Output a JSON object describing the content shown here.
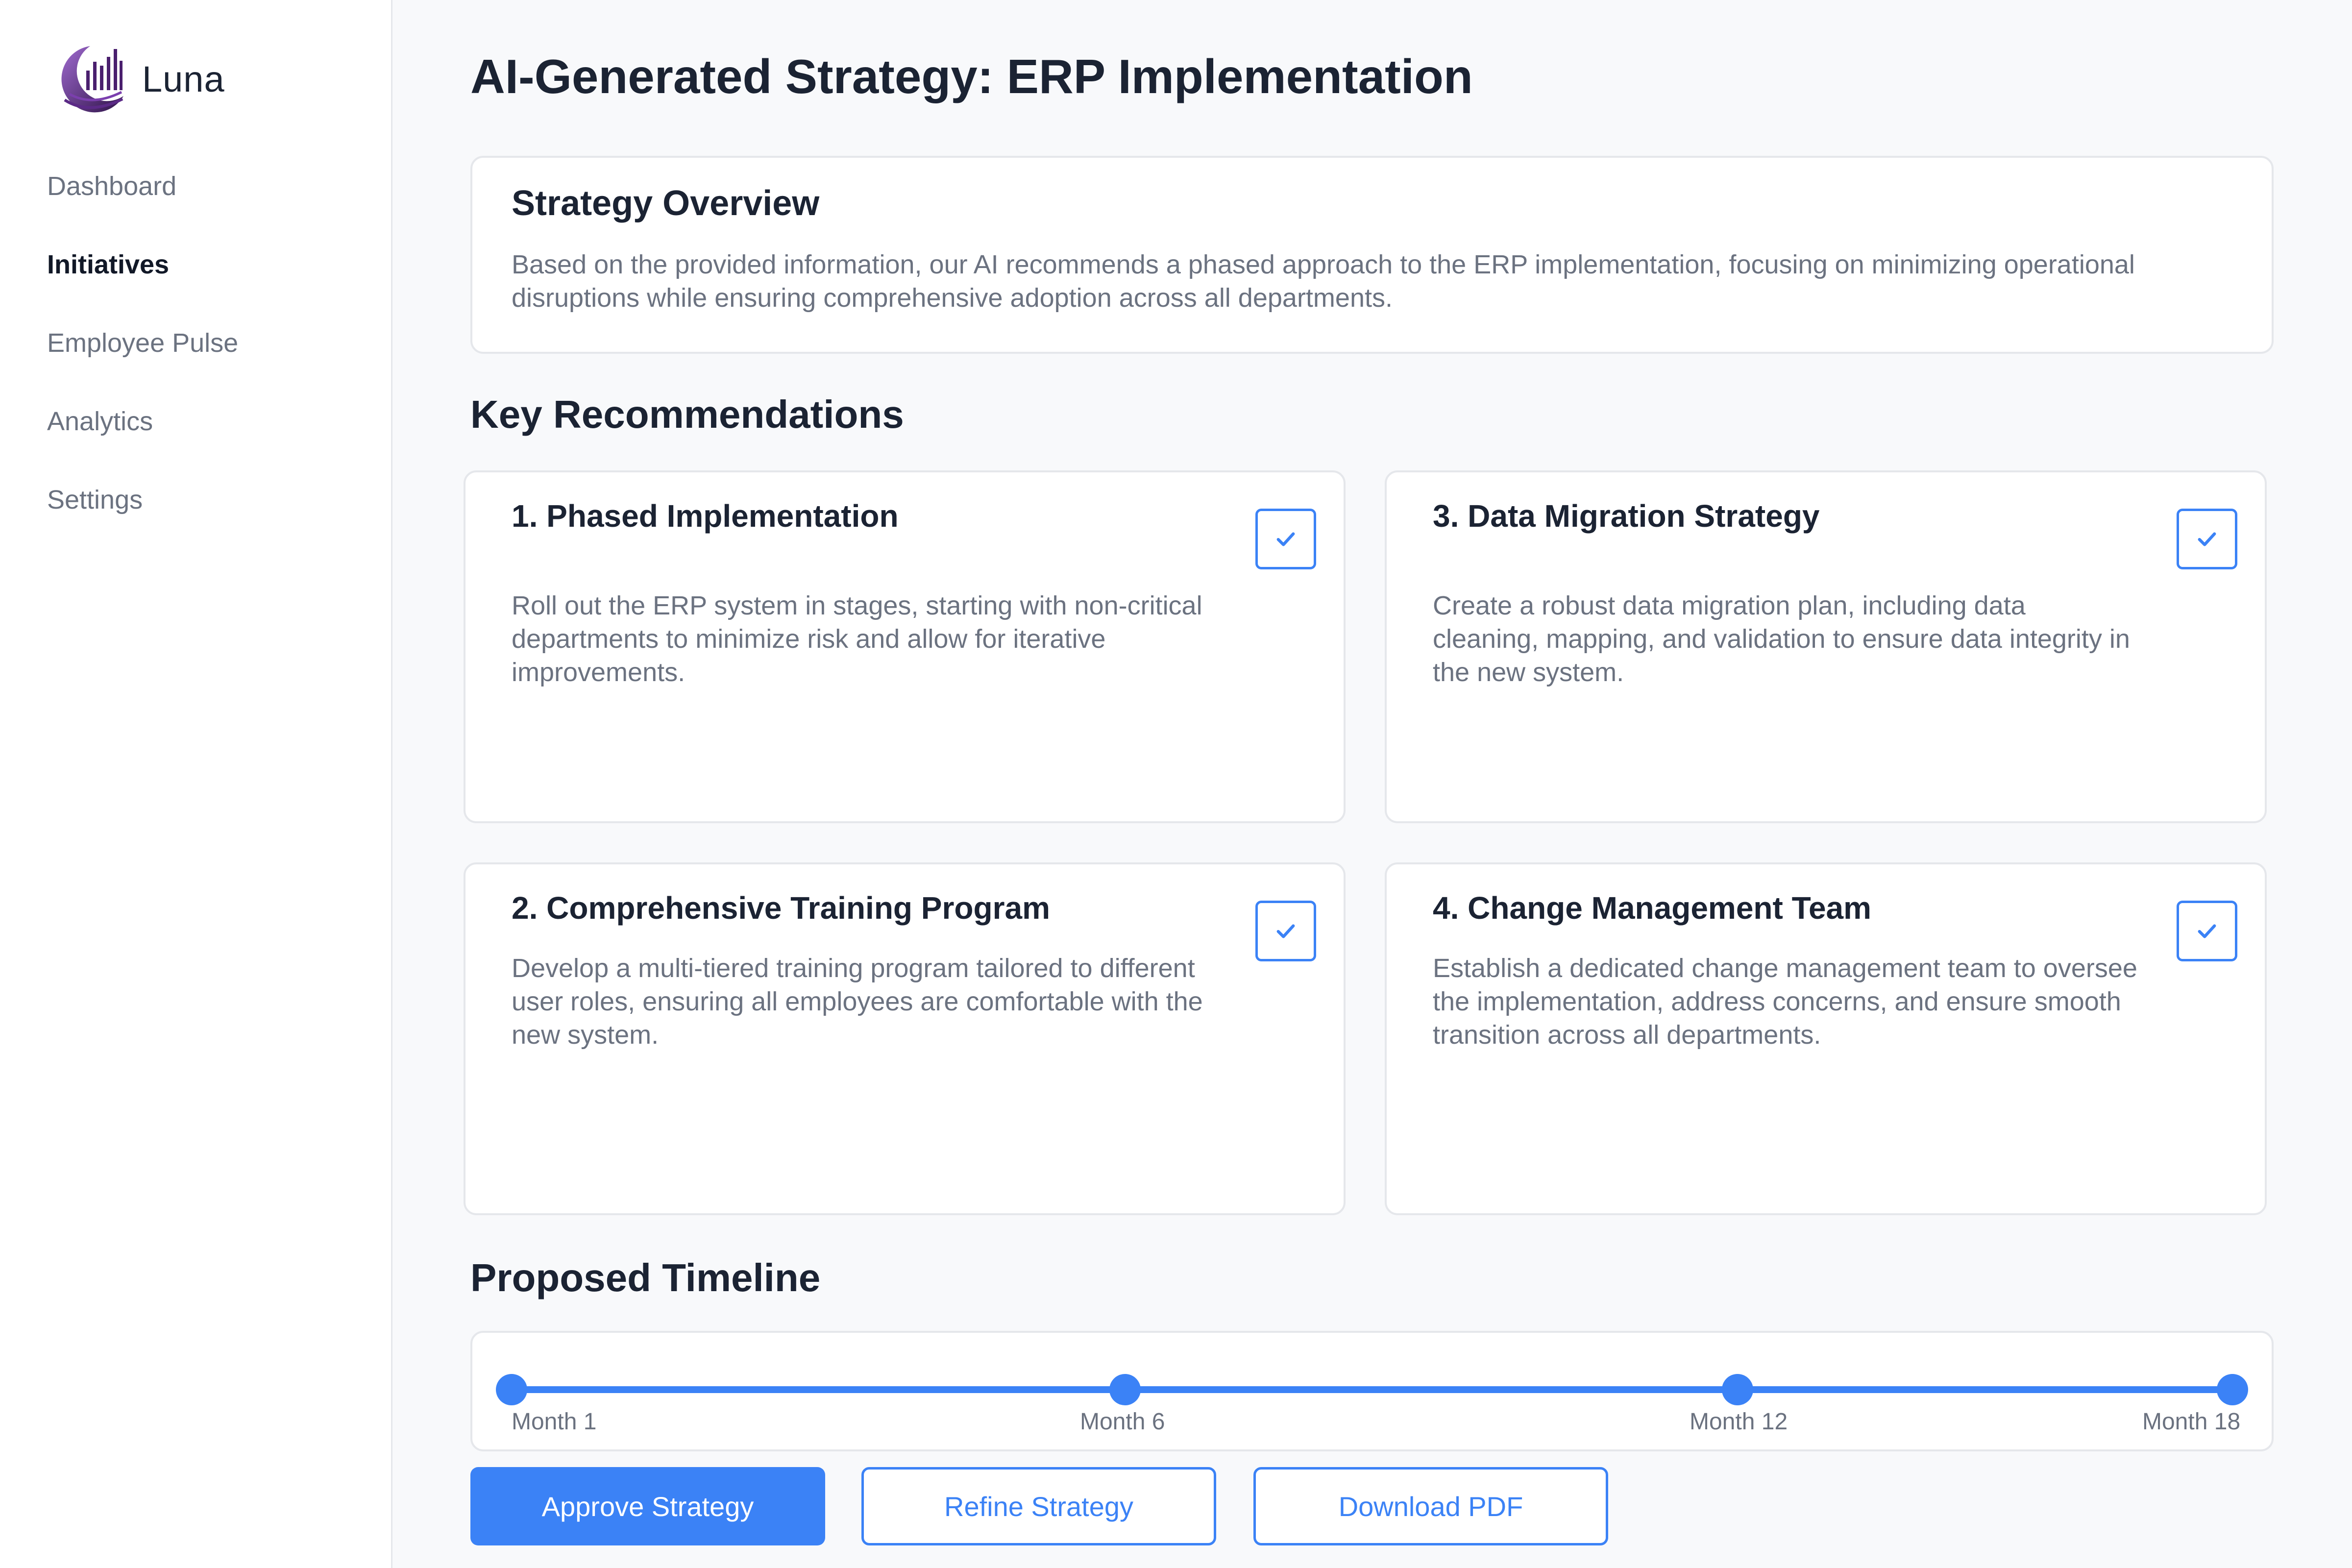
{
  "app": {
    "name": "Luna"
  },
  "sidebar": {
    "items": [
      {
        "label": "Dashboard",
        "active": false
      },
      {
        "label": "Initiatives",
        "active": true
      },
      {
        "label": "Employee Pulse",
        "active": false
      },
      {
        "label": "Analytics",
        "active": false
      },
      {
        "label": "Settings",
        "active": false
      }
    ]
  },
  "page": {
    "title": "AI-Generated Strategy: ERP Implementation"
  },
  "overview": {
    "title": "Strategy Overview",
    "text": "Based on the provided information, our AI recommends a phased approach to the ERP implementation, focusing on minimizing operational disruptions while ensuring comprehensive adoption across all departments."
  },
  "recommendations": {
    "title": "Key Recommendations",
    "items": [
      {
        "title": "1. Phased Implementation",
        "description": "Roll out the ERP system in stages, starting with non-critical departments to minimize risk and allow for iterative improvements.",
        "checked": true
      },
      {
        "title": "3. Data Migration Strategy",
        "description": "Create a robust data migration plan, including data cleaning, mapping, and validation to ensure data integrity in the new system.",
        "checked": true
      },
      {
        "title": "2. Comprehensive Training Program",
        "description": "Develop a multi-tiered training program tailored to different user roles, ensuring all employees are comfortable with the new system.",
        "checked": true
      },
      {
        "title": "4. Change Management Team",
        "description": "Establish a dedicated change management team to oversee the implementation, address concerns, and ensure smooth transition across all departments.",
        "checked": true
      }
    ]
  },
  "timeline": {
    "title": "Proposed Timeline",
    "milestones": [
      "Month 1",
      "Month 6",
      "Month 12",
      "Month 18"
    ]
  },
  "actions": {
    "approve": "Approve Strategy",
    "refine": "Refine Strategy",
    "download": "Download PDF"
  },
  "colors": {
    "accent": "#3b82f6",
    "logo_dark": "#3b1a5c",
    "logo_light": "#9b59b6"
  }
}
